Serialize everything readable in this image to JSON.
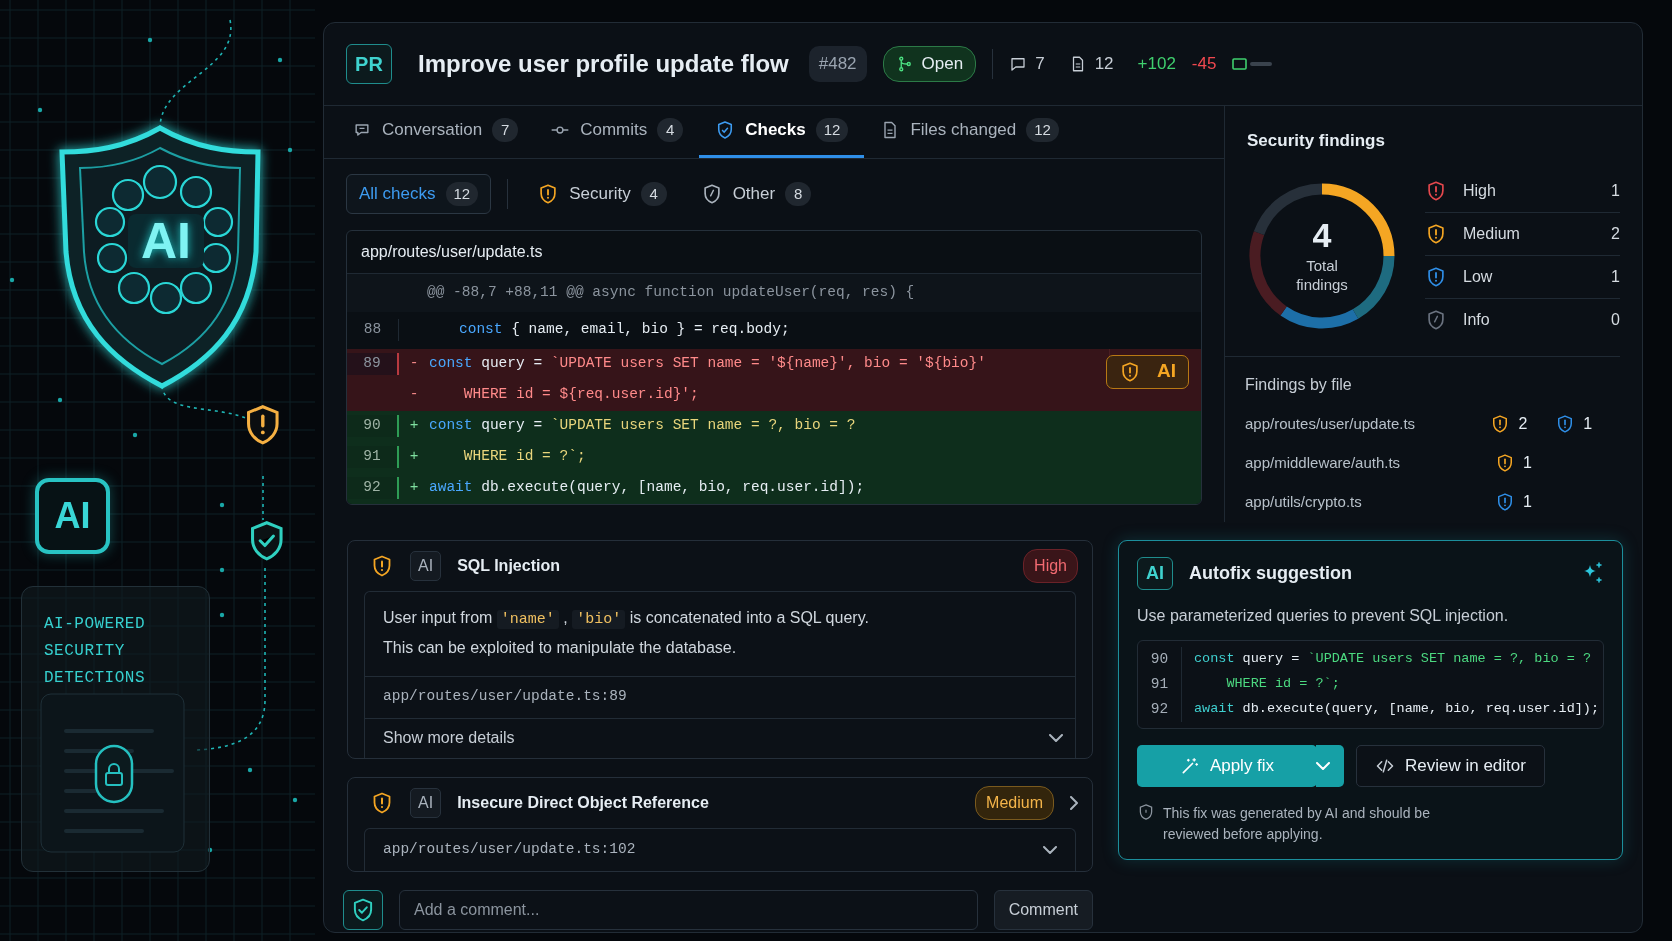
{
  "hero": {
    "logo_text": "AI",
    "badge_text": "AI",
    "caption": "AI-POWERED SECURITY DETECTIONS"
  },
  "header": {
    "badge": "PR",
    "title": "Improve user profile update flow",
    "number": "#482",
    "status": "Open",
    "comments": "7",
    "files": "12",
    "additions": "+102",
    "deletions": "-45"
  },
  "tabs": [
    {
      "kind": "conversation",
      "label": "Conversation",
      "count": "7",
      "selected": false
    },
    {
      "kind": "commits",
      "label": "Commits",
      "count": "4",
      "selected": false
    },
    {
      "kind": "checks",
      "label": "Checks",
      "count": "12",
      "selected": true
    },
    {
      "kind": "files",
      "label": "Files changed",
      "count": "12",
      "selected": false
    }
  ],
  "filters": [
    {
      "kind": "all",
      "label": "All checks",
      "count": "12",
      "selected": true
    },
    {
      "kind": "security",
      "label": "Security",
      "count": "4",
      "selected": false
    },
    {
      "kind": "other",
      "label": "Other",
      "count": "8",
      "selected": false
    }
  ],
  "diff": {
    "file": "app/routes/user/update.ts",
    "lines": [
      {
        "kind": "hunk",
        "text": "@@ -88,7 +88,11 @@ async function updateUser(req, res) {"
      },
      {
        "kind": "context",
        "number": "88",
        "tokens": [
          {
            "kind": "keyword",
            "text": "const"
          },
          {
            "kind": "plain",
            "text": " { name, email, bio } = req.body;"
          }
        ]
      },
      {
        "kind": "del",
        "number": "89",
        "sign": "-",
        "flag": "AI",
        "tokens": [
          {
            "kind": "keyword",
            "text": "const"
          },
          {
            "kind": "plain",
            "text": " query = "
          },
          {
            "kind": "string",
            "text": "`UPDATE users SET name = '${name}', bio = '${bio}'"
          }
        ]
      },
      {
        "kind": "del",
        "sign": "-",
        "tokens": [
          {
            "kind": "string",
            "text": "    WHERE id = ${req.user.id}';"
          }
        ]
      },
      {
        "kind": "add",
        "number": "90",
        "sign": "+",
        "tokens": [
          {
            "kind": "keyword",
            "text": "const"
          },
          {
            "kind": "plain",
            "text": " query = "
          },
          {
            "kind": "string",
            "text": "`UPDATE users SET name = ?, bio = ?"
          }
        ]
      },
      {
        "kind": "add",
        "number": "91",
        "sign": "+",
        "tokens": [
          {
            "kind": "string",
            "text": "    WHERE id = ?`;"
          }
        ]
      },
      {
        "kind": "add",
        "number": "92",
        "sign": "+",
        "tokens": [
          {
            "kind": "keyword",
            "text": "await"
          },
          {
            "kind": "plain",
            "text": " db.execute(query, [name, bio, req.user.id]);"
          }
        ]
      }
    ]
  },
  "security": {
    "title": "Security findings",
    "total": "4",
    "total_label": "Total findings",
    "items": [
      {
        "label": "High",
        "count": "1",
        "color": "#e5484d"
      },
      {
        "label": "Medium",
        "count": "2",
        "color": "#f5a623"
      },
      {
        "label": "Low",
        "count": "1",
        "color": "#2f8fe8"
      },
      {
        "label": "Info",
        "count": "0",
        "color": "#6b7380"
      }
    ],
    "by_file_title": "Findings by file",
    "files": [
      {
        "path": "app/routes/user/update.ts",
        "counts": [
          {
            "color": "#f5a623",
            "count": "2"
          },
          {
            "color": "#2f8fe8",
            "count": "1"
          }
        ]
      },
      {
        "path": "app/middleware/auth.ts",
        "counts": [
          {
            "color": "#f5a623",
            "count": "1"
          }
        ]
      },
      {
        "path": "app/utils/crypto.ts",
        "counts": [
          {
            "color": "#2f8fe8",
            "count": "1"
          }
        ]
      }
    ]
  },
  "findings": [
    {
      "kind": "high",
      "severity_label": "High",
      "tag": "AI",
      "title": "SQL Injection",
      "expanded": true,
      "description": [
        {
          "kind": "text",
          "text": "User input from "
        },
        {
          "kind": "code",
          "text": "'name'"
        },
        {
          "kind": "text",
          "text": " , "
        },
        {
          "kind": "code",
          "text": "'bio'"
        },
        {
          "kind": "text",
          "text": " is concatenated into a SQL query."
        }
      ],
      "description_2": "This can be exploited to manipulate the database.",
      "location": "app/routes/user/update.ts:89",
      "more": "Show more details"
    },
    {
      "kind": "medium",
      "severity_label": "Medium",
      "tag": "AI",
      "title": "Insecure Direct Object Reference",
      "expanded": false,
      "location": "app/routes/user/update.ts:102"
    }
  ],
  "comment": {
    "placeholder": "Add a comment...",
    "button": "Comment"
  },
  "autofix": {
    "tag": "AI",
    "title": "Autofix suggestion",
    "description": "Use parameterized queries to prevent SQL injection.",
    "lines": [
      {
        "number": "90",
        "tokens": [
          {
            "kind": "keyword",
            "text": "const"
          },
          {
            "kind": "plain",
            "text": " query = "
          },
          {
            "kind": "string",
            "text": "`UPDATE users SET name = ?, bio = ?"
          }
        ]
      },
      {
        "number": "91",
        "tokens": [
          {
            "kind": "string",
            "text": "    WHERE id = ?`;"
          }
        ]
      },
      {
        "number": "92",
        "tokens": [
          {
            "kind": "keyword",
            "text": "await"
          },
          {
            "kind": "plain",
            "text": " db.execute(query, [name, bio, req.user.id]);"
          }
        ]
      }
    ],
    "apply": "Apply fix",
    "review": "Review in editor",
    "note": "This fix was generated by AI and should be reviewed before applying."
  }
}
